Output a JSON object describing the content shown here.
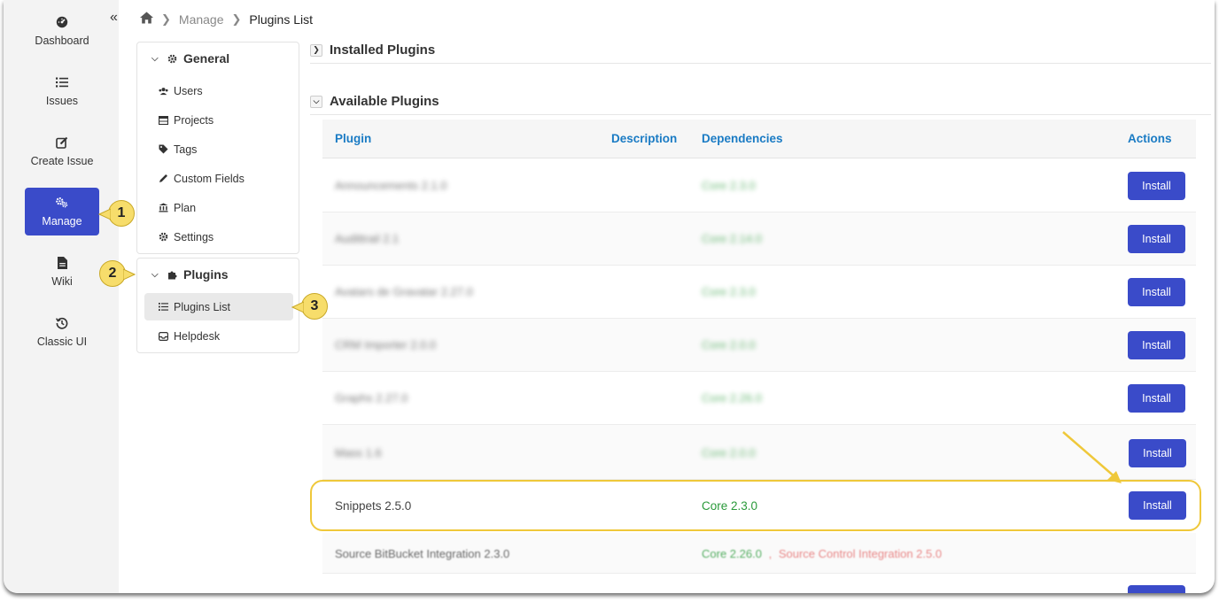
{
  "rail": {
    "collapse_glyph": "«",
    "items": [
      {
        "label": "Dashboard",
        "icon": "dashboard-icon"
      },
      {
        "label": "Issues",
        "icon": "list-icon"
      },
      {
        "label": "Create Issue",
        "icon": "edit-icon"
      },
      {
        "label": "Manage",
        "icon": "gears-icon",
        "active": true
      },
      {
        "label": "Wiki",
        "icon": "document-icon"
      },
      {
        "label": "Classic UI",
        "icon": "history-icon"
      }
    ]
  },
  "breadcrumb": {
    "home_icon": "home-icon",
    "items": [
      "Manage",
      "Plugins List"
    ]
  },
  "menu": {
    "general": {
      "title": "General",
      "items": [
        "Users",
        "Projects",
        "Tags",
        "Custom Fields",
        "Plan",
        "Settings"
      ]
    },
    "plugins": {
      "title": "Plugins",
      "items": [
        "Plugins List",
        "Helpdesk"
      ],
      "active": "Plugins List"
    }
  },
  "callouts": [
    "1",
    "2",
    "3"
  ],
  "sections": {
    "installed": "Installed Plugins",
    "available": "Available Plugins"
  },
  "table": {
    "headers": {
      "plugin": "Plugin",
      "description": "Description",
      "dependencies": "Dependencies",
      "actions": "Actions"
    },
    "rows": [
      {
        "plugin": "Announcements 2.1.0",
        "dependency": "Core 2.3.0",
        "action": "Install",
        "blurred": true
      },
      {
        "plugin": "Audittrail 2.1",
        "dependency": "Core 2.14.0",
        "action": "Install",
        "blurred": true
      },
      {
        "plugin": "Avatars de Gravatar 2.27.0",
        "dependency": "Core 2.3.0",
        "action": "Install",
        "blurred": true
      },
      {
        "plugin": "CRM Importer 2.0.0",
        "dependency": "Core 2.0.0",
        "action": "Install",
        "blurred": true
      },
      {
        "plugin": "Graphs 2.27.0",
        "dependency": "Core 2.26.0",
        "action": "Install",
        "blurred": true
      },
      {
        "plugin": "Mass 1.6",
        "dependency": "Core 2.0.0",
        "action": "Install",
        "blurred": true
      },
      {
        "plugin": "Snippets 2.5.0",
        "dependency": "Core 2.3.0",
        "action": "Install",
        "blurred": false,
        "highlighted": true
      },
      {
        "plugin": "Source BitBucket Integration 2.3.0",
        "dependency": "Core 2.26.0",
        "dependency_extra": "Source Control Integration 2.5.0",
        "dependency_sep": ",",
        "blurred": true
      }
    ]
  },
  "colors": {
    "accent": "#3a4bc9",
    "header_link": "#1a7bc4",
    "dependency_ok": "#2a9a3a",
    "dependency_missing": "#e46b6b",
    "callout": "#f7dd6b",
    "highlight_border": "#efc83a"
  }
}
